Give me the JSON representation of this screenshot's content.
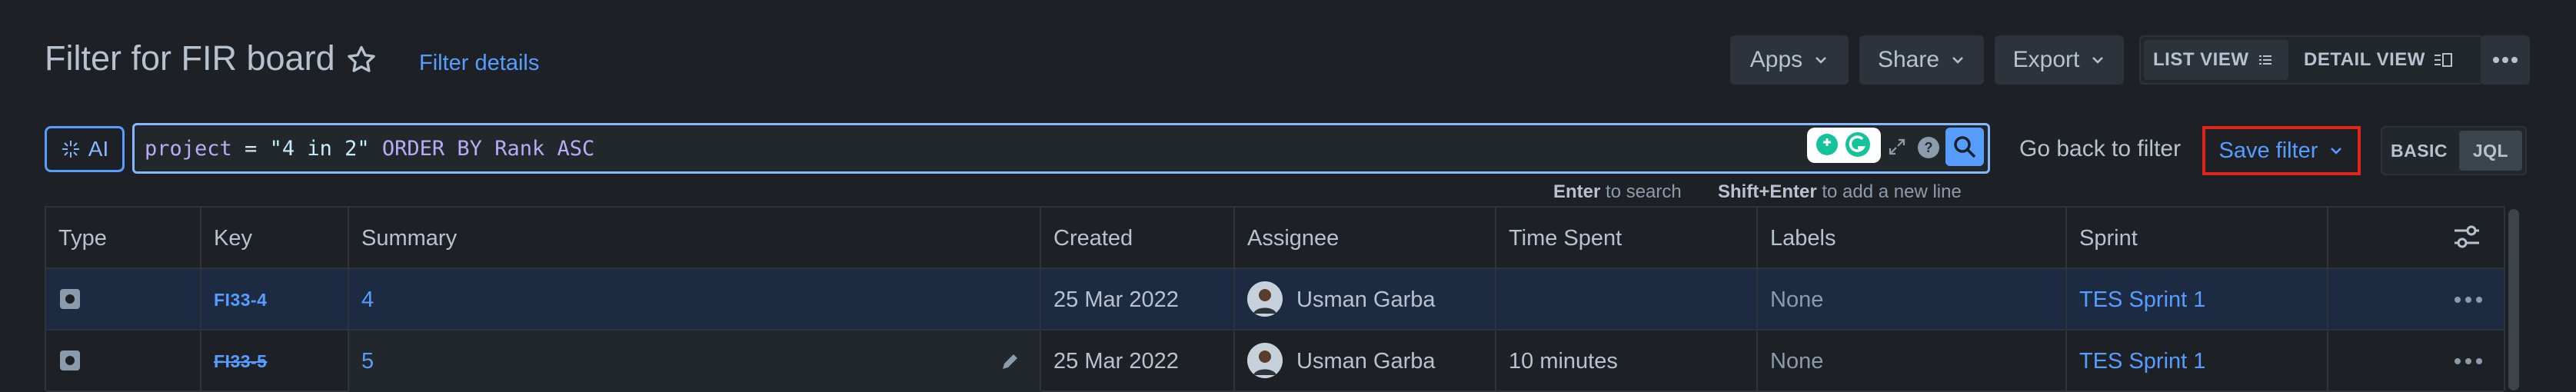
{
  "header": {
    "title": "Filter for FIR board",
    "filter_details": "Filter details",
    "apps": "Apps",
    "share": "Share",
    "export": "Export",
    "list_view": "LIST VIEW",
    "detail_view": "DETAIL VIEW"
  },
  "search": {
    "ai_label": "AI",
    "jql_parts": {
      "kw1": "project",
      "op": " = ",
      "str": "\"4 in 2\"",
      "kw2": " ORDER BY ",
      "kw3": "Rank",
      "kw4": " ASC"
    },
    "hint_enter_key": "Enter",
    "hint_enter_text": " to search",
    "hint_shift_key": "Shift+Enter",
    "hint_shift_text": " to add a new line",
    "go_back": "Go back to filter",
    "save_filter": "Save filter",
    "mode_basic": "BASIC",
    "mode_jql": "JQL"
  },
  "table": {
    "columns": [
      "Type",
      "Key",
      "Summary",
      "Created",
      "Assignee",
      "Time Spent",
      "Labels",
      "Sprint"
    ],
    "rows": [
      {
        "key": "FI33-4",
        "summary": "4",
        "created": "25 Mar 2022",
        "assignee": "Usman Garba",
        "time_spent": "",
        "labels": "None",
        "sprint": "TES Sprint 1"
      },
      {
        "key": "FI33-5",
        "summary": "5",
        "created": "25 Mar 2022",
        "assignee": "Usman Garba",
        "time_spent": "10 minutes",
        "labels": "None",
        "sprint": "TES Sprint 1"
      }
    ]
  },
  "colors": {
    "background": "#1d2125",
    "accent": "#579dff",
    "highlight_border": "#e2251b",
    "selected_row": "#1c2b41"
  },
  "icons": [
    "star-icon",
    "chevron-down-icon",
    "list-icon",
    "detail-view-icon",
    "more-icon",
    "sparkle-icon",
    "grammarly-icon",
    "expand-icon",
    "help-icon",
    "search-icon",
    "column-settings-icon",
    "story-type-icon",
    "edit-icon",
    "avatar"
  ]
}
